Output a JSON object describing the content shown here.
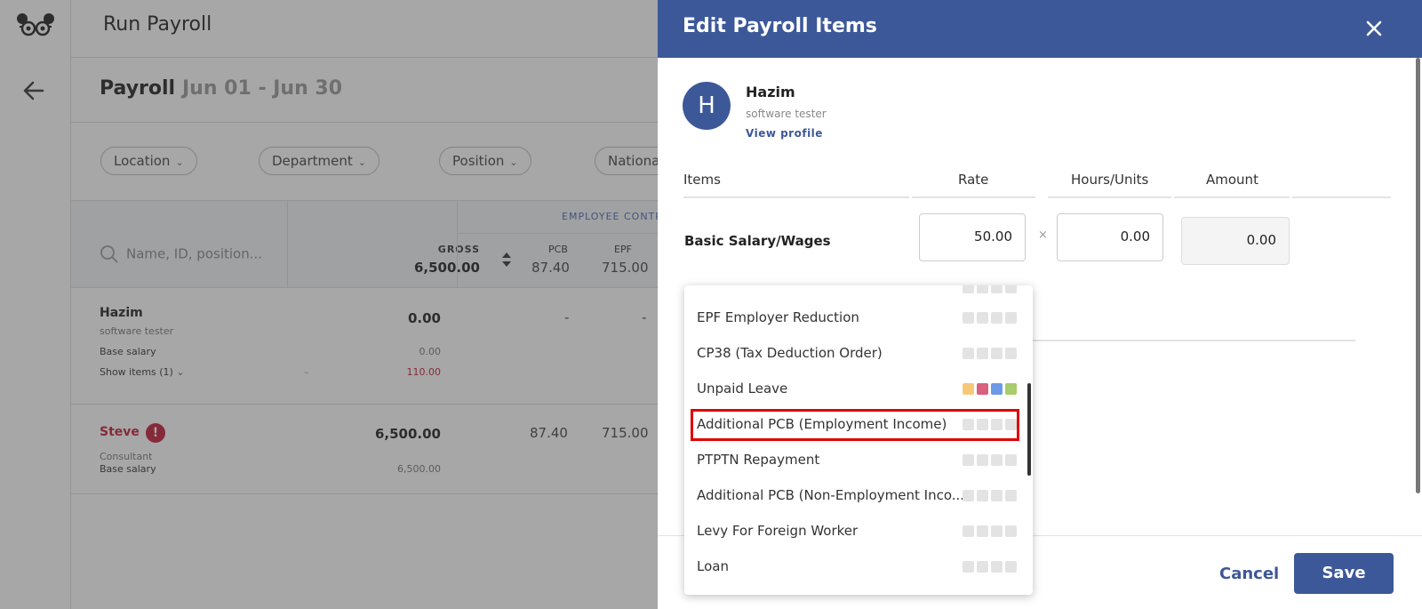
{
  "app": {
    "title": "Run Payroll",
    "payroll_title": "Payroll",
    "payroll_range": "Jun 01 - Jun 30",
    "filters": [
      "Location",
      "Department",
      "Position",
      "Nationa"
    ],
    "table": {
      "search_placeholder": "Name, ID, position...",
      "gross_label": "GROSS",
      "gross_total": "6,500.00",
      "contrib_label": "EMPLOYEE CONTR",
      "col_pcb": "PCB",
      "col_epf": "EPF",
      "pcb_total": "87.40",
      "epf_total": "715.00",
      "rows": [
        {
          "name": "Hazim",
          "position": "software tester",
          "gross": "0.00",
          "pcb": "-",
          "epf": "-",
          "base_label": "Base salary",
          "base_value": "0.00",
          "show_items": "Show items (1)",
          "item_sign": "–",
          "item_value": "110.00"
        },
        {
          "name": "Steve",
          "position": "Consultant",
          "gross": "6,500.00",
          "pcb": "87.40",
          "epf": "715.00",
          "base_label": "Base salary",
          "base_value": "6,500.00",
          "warning": "!"
        }
      ]
    }
  },
  "drawer": {
    "title": "Edit Payroll Items",
    "employee": {
      "initial": "H",
      "name": "Hazim",
      "position": "software tester",
      "view_profile": "View profile"
    },
    "columns": {
      "items": "Items",
      "rate": "Rate",
      "hours": "Hours/Units",
      "amount": "Amount"
    },
    "basic_row": {
      "label": "Basic Salary/Wages",
      "rate": "50.00",
      "times": "×",
      "hours": "0.00",
      "amount": "0.00"
    },
    "cancel_label": "Cancel",
    "save_label": "Save"
  },
  "dropdown": {
    "items": [
      {
        "label": "EPF Employer Reduction",
        "colors": [
          "#e3e3e3",
          "#e3e3e3",
          "#e3e3e3",
          "#e3e3e3"
        ]
      },
      {
        "label": "CP38 (Tax Deduction Order)",
        "colors": [
          "#e3e3e3",
          "#e3e3e3",
          "#e3e3e3",
          "#e3e3e3"
        ]
      },
      {
        "label": "Unpaid Leave",
        "colors": [
          "#f6c87a",
          "#d9607e",
          "#6d9ae6",
          "#a9cd6a"
        ]
      },
      {
        "label": "Additional PCB (Employment Income)",
        "colors": [
          "#e3e3e3",
          "#e3e3e3",
          "#e3e3e3",
          "#e3e3e3"
        ],
        "highlighted": true
      },
      {
        "label": "PTPTN Repayment",
        "colors": [
          "#e3e3e3",
          "#e3e3e3",
          "#e3e3e3",
          "#e3e3e3"
        ]
      },
      {
        "label": "Additional PCB (Non-Employment Inco...",
        "colors": [
          "#e3e3e3",
          "#e3e3e3",
          "#e3e3e3",
          "#e3e3e3"
        ]
      },
      {
        "label": "Levy For Foreign Worker",
        "colors": [
          "#e3e3e3",
          "#e3e3e3",
          "#e3e3e3",
          "#e3e3e3"
        ]
      },
      {
        "label": "Loan",
        "colors": [
          "#e3e3e3",
          "#e3e3e3",
          "#e3e3e3",
          "#e3e3e3"
        ]
      }
    ]
  },
  "colors": {
    "brand": "#3d5898",
    "warning": "#c21d3a",
    "highlight_box": "#e00000"
  }
}
